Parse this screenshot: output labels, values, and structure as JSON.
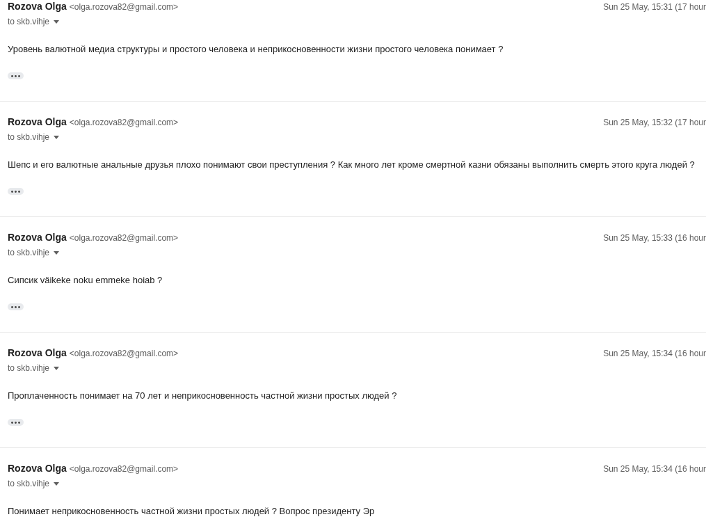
{
  "messages": [
    {
      "sender": "Rozova Olga",
      "email": "<olga.rozova82@gmail.com>",
      "to": "to skb.vihje",
      "date": "Sun 25 May, 15:31 (17 hour",
      "body": "Уровень валютной медиа структуры и простого человека и неприкосновенности жизни простого человека понимает ?"
    },
    {
      "sender": "Rozova Olga",
      "email": "<olga.rozova82@gmail.com>",
      "to": "to skb.vihje",
      "date": "Sun 25 May, 15:32 (17 hour",
      "body": "Шепс и его валютные анальные друзья плохо понимают свои преступления ? Как много лет кроме смертной казни обязаны выполнить смерть этого круга людей ?"
    },
    {
      "sender": "Rozova Olga",
      "email": "<olga.rozova82@gmail.com>",
      "to": "to skb.vihje",
      "date": "Sun 25 May, 15:33 (16 hour",
      "body": "Сипсик väikeke noku emmeke hoiab ?"
    },
    {
      "sender": "Rozova Olga",
      "email": "<olga.rozova82@gmail.com>",
      "to": "to skb.vihje",
      "date": "Sun 25 May, 15:34 (16 hour",
      "body": "Проплаченность понимает на 70 лет и неприкосновенность частной жизни простых людей ?"
    },
    {
      "sender": "Rozova Olga",
      "email": "<olga.rozova82@gmail.com>",
      "to": "to skb.vihje",
      "date": "Sun 25 May, 15:34 (16 hour",
      "body": "Понимает неприкосновенность частной жизни простых людей ? Вопрос президенту Эр"
    }
  ]
}
